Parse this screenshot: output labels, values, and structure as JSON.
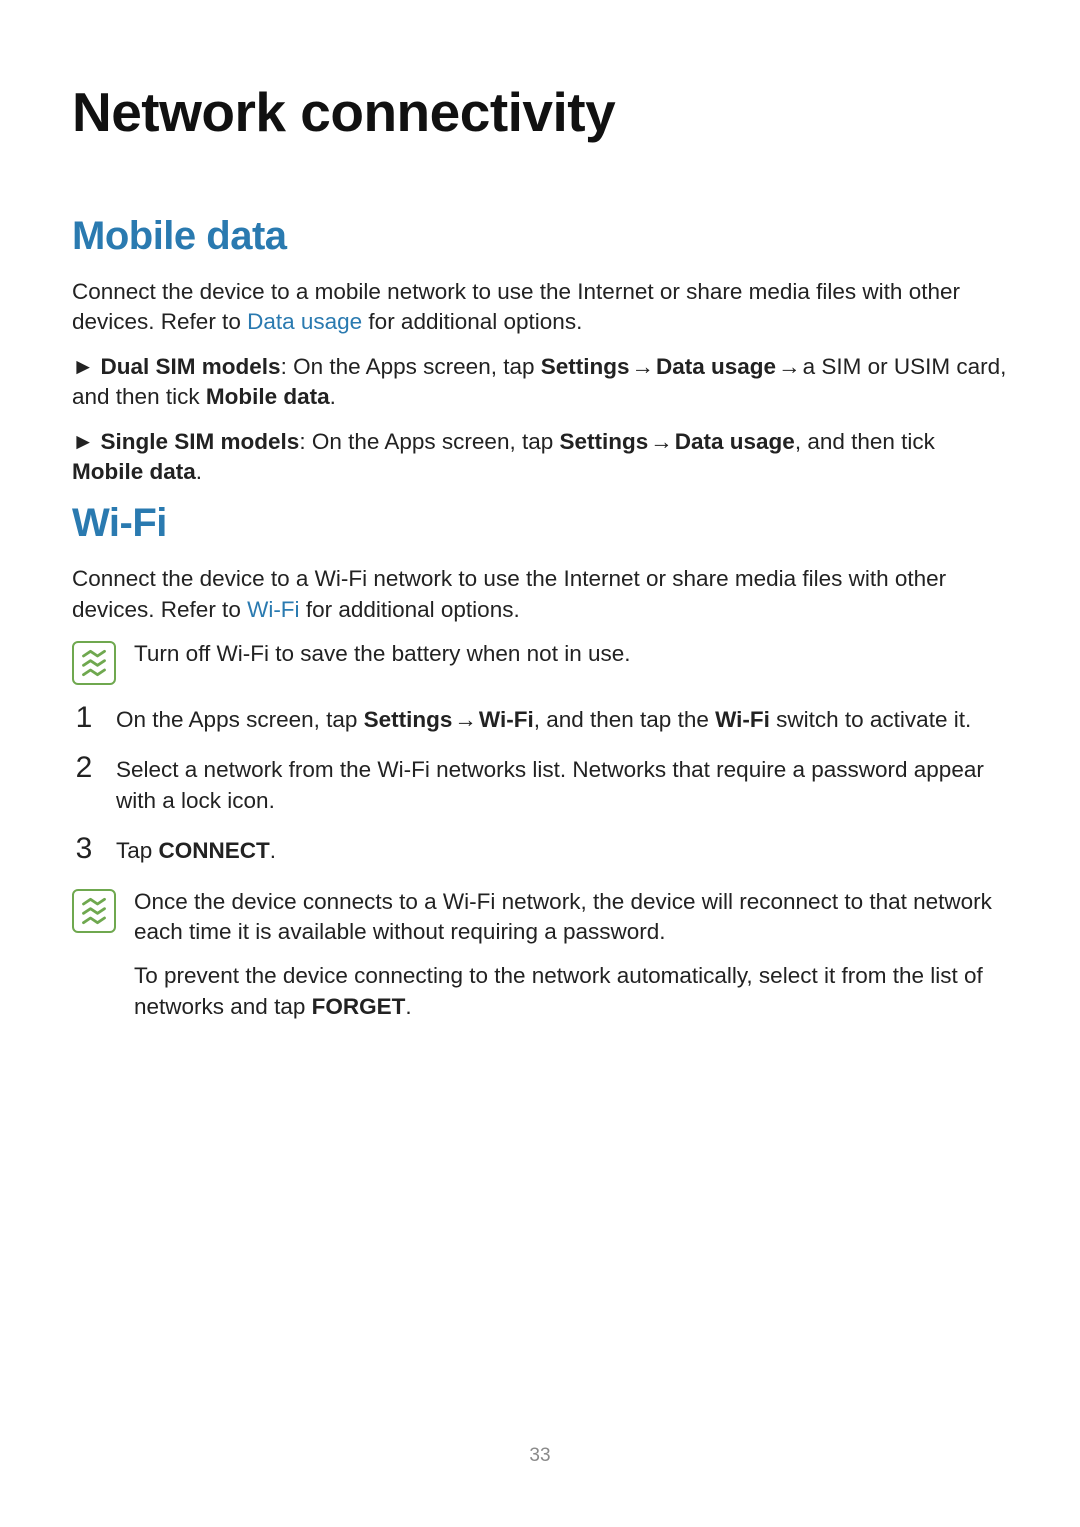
{
  "page_number": "33",
  "chapter_title": "Network connectivity",
  "mobile_data": {
    "heading": "Mobile data",
    "intro_pre": "Connect the device to a mobile network to use the Internet or share media files with other devices. Refer to ",
    "intro_link": "Data usage",
    "intro_post": " for additional options.",
    "dual": {
      "marker": "► ",
      "label": "Dual SIM models",
      "sep": ": On the Apps screen, tap ",
      "b1": "Settings",
      "arr1": " → ",
      "b2": "Data usage",
      "arr2": " → ",
      "tail1": "a SIM or USIM card, and then tick ",
      "b3": "Mobile data",
      "end": "."
    },
    "single": {
      "marker": "► ",
      "label": "Single SIM models",
      "sep": ": On the Apps screen, tap ",
      "b1": "Settings",
      "arr1": " → ",
      "b2": "Data usage",
      "tail1": ", and then tick ",
      "b3": "Mobile data",
      "end": "."
    }
  },
  "wifi": {
    "heading": "Wi-Fi",
    "intro_pre": "Connect the device to a Wi-Fi network to use the Internet or share media files with other devices. Refer to ",
    "intro_link": "Wi-Fi",
    "intro_post": " for additional options.",
    "note1": "Turn off Wi-Fi to save the battery when not in use.",
    "steps": {
      "s1": {
        "num": "1",
        "pre": "On the Apps screen, tap ",
        "b1": "Settings",
        "arr1": " → ",
        "b2": "Wi-Fi",
        "mid": ", and then tap the ",
        "b3": "Wi-Fi",
        "post": " switch to activate it."
      },
      "s2": {
        "num": "2",
        "text": "Select a network from the Wi-Fi networks list. Networks that require a password appear with a lock icon."
      },
      "s3": {
        "num": "3",
        "pre": "Tap ",
        "b1": "CONNECT",
        "post": "."
      }
    },
    "note2": {
      "p1": "Once the device connects to a Wi-Fi network, the device will reconnect to that network each time it is available without requiring a password.",
      "p2_pre": "To prevent the device connecting to the network automatically, select it from the list of networks and tap ",
      "p2_b": "FORGET",
      "p2_post": "."
    }
  }
}
